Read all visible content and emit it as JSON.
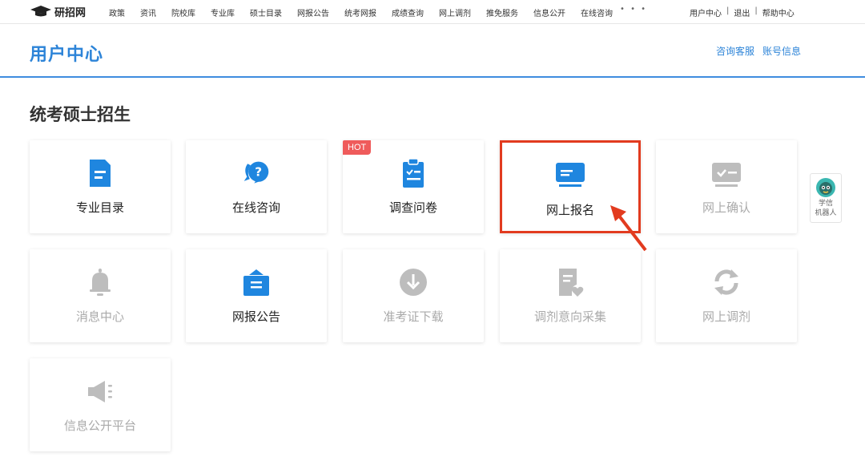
{
  "brand": {
    "name": "研招网"
  },
  "nav": [
    "政策",
    "资讯",
    "院校库",
    "专业库",
    "硕士目录",
    "网报公告",
    "统考网报",
    "成绩查询",
    "网上调剂",
    "推免服务",
    "信息公开",
    "在线咨询"
  ],
  "nav_more": "• • •",
  "user_links": [
    "用户中心",
    "退出",
    "帮助中心"
  ],
  "page_title": "用户中心",
  "header_links": [
    "咨询客服",
    "账号信息"
  ],
  "section_title": "统考硕士招生",
  "cards": [
    {
      "label": "专业目录",
      "icon": "document-icon",
      "enabled": true
    },
    {
      "label": "在线咨询",
      "icon": "question-chat-icon",
      "enabled": true
    },
    {
      "label": "调查问卷",
      "icon": "clipboard-check-icon",
      "enabled": true,
      "badge": "HOT"
    },
    {
      "label": "网上报名",
      "icon": "card-icon",
      "enabled": true
    },
    {
      "label": "网上确认",
      "icon": "confirm-icon",
      "enabled": false
    },
    {
      "label": "消息中心",
      "icon": "bell-icon",
      "enabled": false
    },
    {
      "label": "网报公告",
      "icon": "bag-list-icon",
      "enabled": true
    },
    {
      "label": "准考证下载",
      "icon": "download-icon",
      "enabled": false
    },
    {
      "label": "调剂意向采集",
      "icon": "document-heart-icon",
      "enabled": false
    },
    {
      "label": "网上调剂",
      "icon": "refresh-icon",
      "enabled": false
    },
    {
      "label": "信息公开平台",
      "icon": "megaphone-icon",
      "enabled": false
    }
  ],
  "robot": {
    "line1": "学信",
    "line2": "机器人"
  },
  "colors": {
    "accent": "#2d84d8",
    "icon_blue": "#1f86df",
    "disabled": "#bdbdbd",
    "highlight": "#e23b1f",
    "hot": "#ef5b5b"
  }
}
